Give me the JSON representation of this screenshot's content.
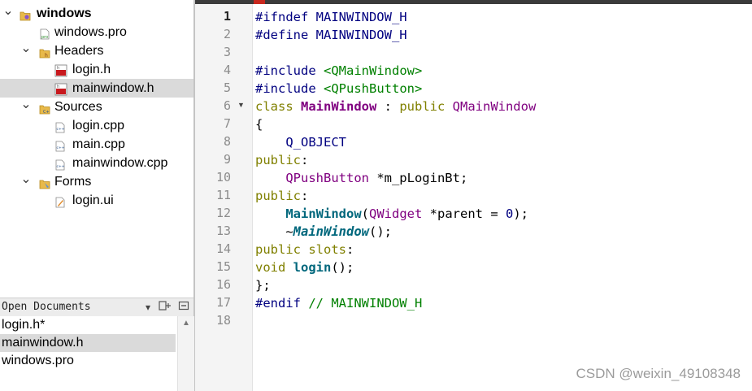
{
  "project_tree": {
    "items": [
      {
        "label": "windows",
        "icon": "project-icon",
        "bold": true,
        "expanded": true
      },
      {
        "label": "windows.pro",
        "icon": "pro-file-icon"
      },
      {
        "label": "Headers",
        "icon": "headers-folder-icon",
        "expanded": true
      },
      {
        "label": "login.h",
        "icon": "header-file-icon"
      },
      {
        "label": "mainwindow.h",
        "icon": "header-file-icon",
        "selected": true
      },
      {
        "label": "Sources",
        "icon": "sources-folder-icon",
        "expanded": true
      },
      {
        "label": "login.cpp",
        "icon": "cpp-file-icon"
      },
      {
        "label": "main.cpp",
        "icon": "cpp-file-icon"
      },
      {
        "label": "mainwindow.cpp",
        "icon": "cpp-file-icon"
      },
      {
        "label": "Forms",
        "icon": "forms-folder-icon",
        "expanded": true
      },
      {
        "label": "login.ui",
        "icon": "ui-file-icon"
      }
    ]
  },
  "open_documents": {
    "title": "Open Documents",
    "items": [
      "login.h*",
      "mainwindow.h",
      "windows.pro"
    ],
    "selected_index": 1
  },
  "editor": {
    "line_numbers": [
      "1",
      "2",
      "3",
      "4",
      "5",
      "6",
      "7",
      "8",
      "9",
      "10",
      "11",
      "12",
      "13",
      "14",
      "15",
      "16",
      "17",
      "18"
    ],
    "current_line": 1,
    "lines": [
      [
        {
          "t": "#ifndef MAINWINDOW_H",
          "c": "pre"
        }
      ],
      [
        {
          "t": "#define MAINWINDOW_H",
          "c": "pre"
        }
      ],
      [],
      [
        {
          "t": "#include ",
          "c": "pre"
        },
        {
          "t": "<QMainWindow>",
          "c": "inc"
        }
      ],
      [
        {
          "t": "#include ",
          "c": "pre"
        },
        {
          "t": "<QPushButton>",
          "c": "inc"
        }
      ],
      [
        {
          "t": "class ",
          "c": "kw"
        },
        {
          "t": "MainWindow",
          "c": "cls"
        },
        {
          "t": " : ",
          "c": "def"
        },
        {
          "t": "public ",
          "c": "kw"
        },
        {
          "t": "QMainWindow",
          "c": "type"
        }
      ],
      [
        {
          "t": "{",
          "c": "def"
        }
      ],
      [
        {
          "t": "    Q_OBJECT",
          "c": "mac"
        }
      ],
      [
        {
          "t": "public",
          "c": "kw"
        },
        {
          "t": ":",
          "c": "def"
        }
      ],
      [
        {
          "t": "    QPushButton",
          "c": "type"
        },
        {
          "t": " *m_pLoginBt;",
          "c": "def"
        }
      ],
      [
        {
          "t": "public",
          "c": "kw"
        },
        {
          "t": ":",
          "c": "def"
        }
      ],
      [
        {
          "t": "    MainWindow",
          "c": "fn"
        },
        {
          "t": "(",
          "c": "def"
        },
        {
          "t": "QWidget",
          "c": "type"
        },
        {
          "t": " *parent = ",
          "c": "def"
        },
        {
          "t": "0",
          "c": "num"
        },
        {
          "t": ");",
          "c": "def"
        }
      ],
      [
        {
          "t": "    ~",
          "c": "def"
        },
        {
          "t": "MainWindow",
          "c": "fni"
        },
        {
          "t": "();",
          "c": "def"
        }
      ],
      [
        {
          "t": "public ",
          "c": "kw"
        },
        {
          "t": "slots",
          "c": "kw"
        },
        {
          "t": ":",
          "c": "def"
        }
      ],
      [
        {
          "t": "void ",
          "c": "kw"
        },
        {
          "t": "login",
          "c": "fn"
        },
        {
          "t": "();",
          "c": "def"
        }
      ],
      [
        {
          "t": "};",
          "c": "def"
        }
      ],
      [
        {
          "t": "#endif ",
          "c": "pre"
        },
        {
          "t": "// MAINWINDOW_H",
          "c": "cmt"
        }
      ],
      []
    ]
  },
  "watermark": "CSDN @weixin_49108348",
  "colors": {
    "preprocessor": "#000080",
    "include_path": "#008000",
    "keyword": "#808000",
    "type": "#800080",
    "function": "#00677c",
    "selection": "#dadada"
  }
}
